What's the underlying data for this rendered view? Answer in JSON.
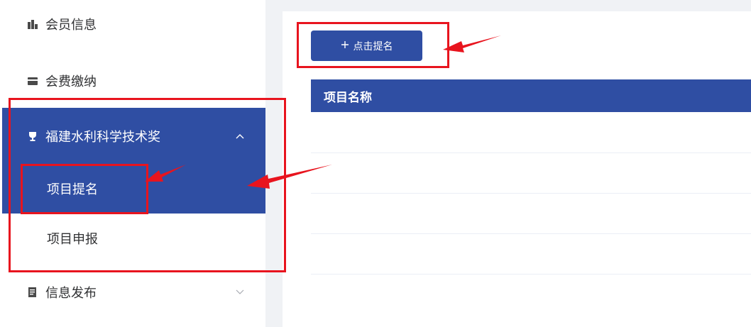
{
  "sidebar": {
    "items": [
      {
        "label": "会员信息",
        "icon": "chart-icon"
      },
      {
        "label": "会费缴纳",
        "icon": "card-icon"
      },
      {
        "label": "福建水利科学技术奖",
        "icon": "trophy-icon",
        "expanded": true,
        "children": [
          {
            "label": "项目提名",
            "active": true
          },
          {
            "label": "项目申报"
          }
        ]
      },
      {
        "label": "信息发布",
        "icon": "document-icon",
        "expanded": false
      }
    ]
  },
  "toolbar": {
    "nominate_label": "点击提名",
    "nominate_icon": "plus-icon"
  },
  "table": {
    "columns": [
      "项目名称"
    ],
    "rows": []
  },
  "colors": {
    "primary": "#2f4ea3",
    "annotation": "#e8141e",
    "text": "#303133",
    "background_gray": "#f0f2f5"
  }
}
